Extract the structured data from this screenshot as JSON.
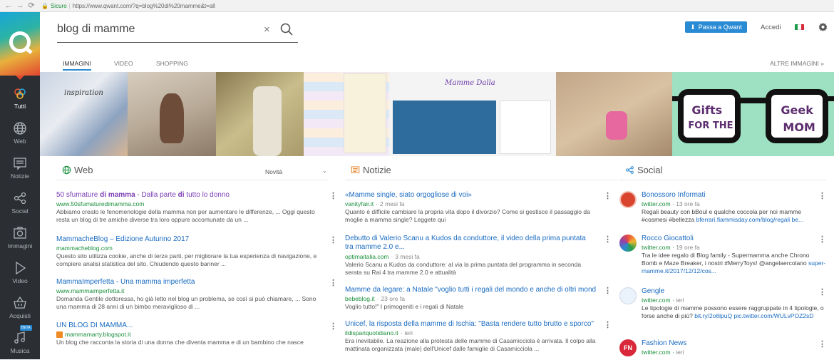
{
  "browser": {
    "secure_label": "Sicuro",
    "url": "https://www.qwant.com/?q=blog%20di%20mamme&t=all"
  },
  "sidebar": {
    "items": [
      {
        "label": "Tutti",
        "icon": "tutti-icon"
      },
      {
        "label": "Web",
        "icon": "globe-icon"
      },
      {
        "label": "Notizie",
        "icon": "news-icon"
      },
      {
        "label": "Social",
        "icon": "social-icon"
      },
      {
        "label": "Immagini",
        "icon": "camera-icon"
      },
      {
        "label": "Video",
        "icon": "play-icon"
      },
      {
        "label": "Acquisti",
        "icon": "basket-icon"
      },
      {
        "label": "Musica",
        "icon": "music-icon"
      }
    ],
    "beta_badge": "BETA"
  },
  "search": {
    "query": "blog di mamme"
  },
  "header": {
    "pass_button": "Passa a Qwant",
    "login": "Accedi"
  },
  "tabs": [
    "IMMAGINI",
    "VIDEO",
    "SHOPPING"
  ],
  "more_images": "ALTRE IMMAGINI",
  "images": {
    "gifts_top_left": "Gifts",
    "gifts_bottom_left": "FOR THE",
    "gifts_top_right": "Geek",
    "gifts_bottom_right": "MOM",
    "blog_caption": "Mamme Dalla"
  },
  "web": {
    "heading": "Web",
    "sort": "Novità",
    "results": [
      {
        "title_parts": [
          "50 sfumature ",
          "di",
          " ",
          "mamma",
          " - Dalla parte ",
          "di",
          " tutto lo donno"
        ],
        "url": "www.50sfumaturedimamma.com",
        "desc": "Abbiamo creato le fenomenologie della mamma non per aumentare le differenze, ... Oggi questo resta un blog di tre amiche diverse tra loro oppure accomunate da un ..."
      },
      {
        "title": "MammacheBlog – Edizione Autunno 2017",
        "url": "mammacheblog.com",
        "desc": "Questo sito utilizza cookie, anche di terze parti, per migliorare la tua esperienza di navigazione, e compiere analisi statistica del sito. Chiudendo questo banner ..."
      },
      {
        "title": "MammaImperfetta - Una mamma imperfetta",
        "url": "www.mammaimperfetta.it",
        "desc": "Domanda Gentile dottoressa, ho già letto nel blog un problema, se così si può chiamare, ... Sono una mamma di 28 anni di un bimbo meraviglioso di ..."
      },
      {
        "title": "UN BLOG DI MAMMA...",
        "url": "mammamarty.blogspot.it",
        "desc": "Un blog che racconta la storia di una donna che diventa mamma e di un bambino che nasce"
      }
    ]
  },
  "news": {
    "heading": "Notizie",
    "results": [
      {
        "title": "«Mamme single, siato orgogliose di voi»",
        "url": "vanityfair.it",
        "time": "2 mesi fa",
        "desc": "Quanto è difficile cambiare la propria vita dopo il divorzio? Come si gestisce il passaggio da moglie a mamma single? Leggete qui"
      },
      {
        "title": "Debutto di Valerio Scanu a Kudos da conduttore, il video della prima puntata tra mamme 2.0 e...",
        "url": "optimaitalia.com",
        "time": "3 mesi fa",
        "desc": "Valerio Scanu a Kudos da conduttore: al via la prima puntata del programma in seconda serata su Rai 4 tra mamme 2.0 e attualità"
      },
      {
        "title": "Mamme da legare: a Natale \"voglio tutti i regali del mondo e anche di oltri mondi\"",
        "url": "bebeblog.it",
        "time": "23 ore fa",
        "desc": "Voglio tutto!\" I primogeniti e i regali di Natale"
      },
      {
        "title": "Unicef, la risposta della mamme di Ischia: \"Basta rendere tutto brutto e sporco\"",
        "url": "ildispariquotidiano.it",
        "time": "ieri",
        "desc": "Era inevitabile. La reazione alla protesta delle mamme di Casamicciola è arrivata. Il colpo alla mattinata organizzata (male) dell'Unicef dalle famiglie di Casamicciola ..."
      }
    ]
  },
  "social": {
    "heading": "Social",
    "items": [
      {
        "name": "Bonossoro Informati",
        "src": "twitter.com",
        "time": "13 ore fa",
        "text": "Regali beauty con bBoul e qualche coccola per noi mamme #cosmesi #bellezza",
        "link": "bferrari.fiammisday.com/blog/regali be..."
      },
      {
        "name": "Rocco Giocattoli",
        "src": "twitter.com",
        "time": "19 ore fa",
        "text": "Tra le idee regalo di Blog family - Supermamma anche Chrono Bomb e Maze Breaker, i nostri #MerryToys! @angelaercolano",
        "link": "super-mamme.it/2017/12/12/cos..."
      },
      {
        "name": "Gengle",
        "src": "twitter.com",
        "time": "ieri",
        "text": "Le tipologie di mamme possono essere raggruppate in 4 tipologie, o forse anche di più?",
        "link": "bit.ry/2o6lpuQ pic.twitter.com/WULvPOZ2sD"
      },
      {
        "name": "Fashion News",
        "src": "twitter.com",
        "time": "ieri",
        "text": "",
        "link": ""
      }
    ]
  }
}
